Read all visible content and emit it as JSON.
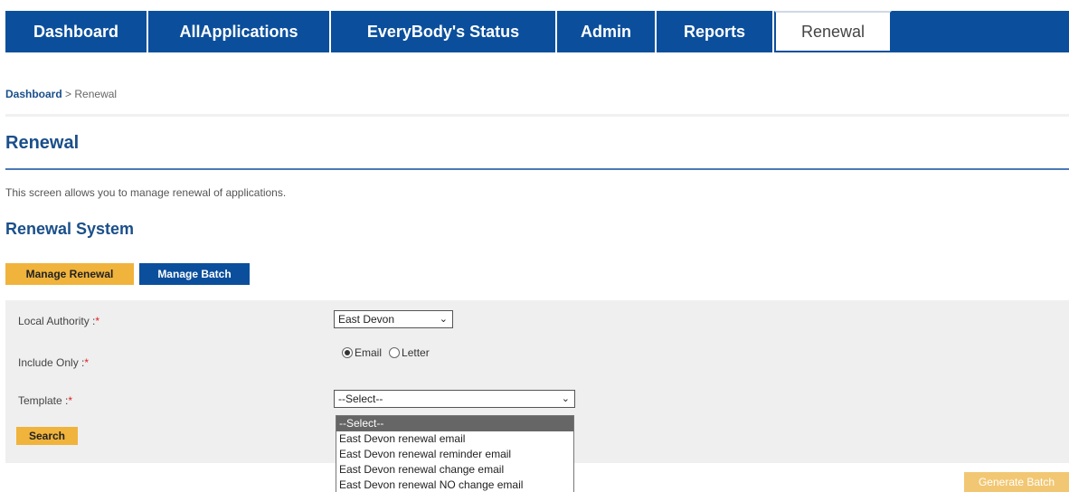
{
  "nav": {
    "tabs": [
      {
        "label": "Dashboard"
      },
      {
        "label": "AllApplications"
      },
      {
        "label": "EveryBody's Status"
      },
      {
        "label": "Admin"
      },
      {
        "label": "Reports"
      },
      {
        "label": "Renewal"
      }
    ],
    "active_tab": "Renewal"
  },
  "breadcrumb": {
    "root": "Dashboard",
    "separator": " > ",
    "current": "Renewal"
  },
  "page": {
    "title": "Renewal",
    "description": "This screen allows you to manage renewal of applications.",
    "section_title": "Renewal System"
  },
  "buttons": {
    "manage_renewal": "Manage Renewal",
    "manage_batch": "Manage Batch",
    "search": "Search",
    "generate_batch": "Generate Batch"
  },
  "form": {
    "local_authority": {
      "label": "Local Authority :",
      "required": "*",
      "value": "East Devon"
    },
    "include_only": {
      "label": "Include Only :",
      "required": "*",
      "options": [
        "Email",
        "Letter"
      ],
      "selected": "Email"
    },
    "template": {
      "label": "Template :",
      "required": "*",
      "value": "--Select--",
      "options": [
        "--Select--",
        "East Devon renewal email",
        "East Devon renewal reminder email",
        "East Devon renewal change email",
        "East Devon renewal NO change email"
      ],
      "highlighted": "--Select--"
    }
  },
  "colors": {
    "nav_bg": "#0b4f9c",
    "accent_yellow": "#f0b33c",
    "title_blue": "#1a4f8a",
    "required_red": "#e02020"
  }
}
